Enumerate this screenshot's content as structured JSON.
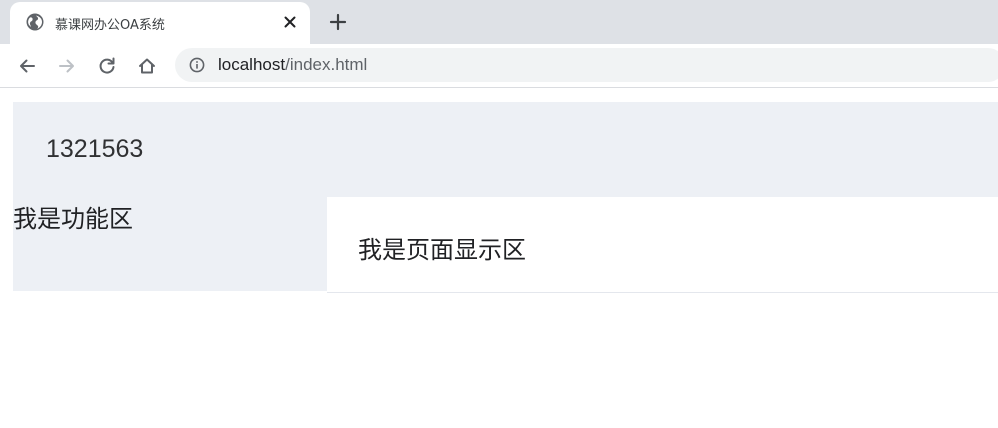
{
  "browser": {
    "tab": {
      "title": "慕课网办公OA系统",
      "favicon": "globe-icon",
      "close_icon": "close-icon"
    },
    "new_tab_icon": "plus-icon",
    "nav": {
      "back_icon": "back-arrow-icon",
      "forward_icon": "forward-arrow-icon",
      "reload_icon": "reload-icon",
      "home_icon": "home-icon"
    },
    "address_bar": {
      "info_icon": "info-icon",
      "host": "localhost",
      "path": "/index.html"
    }
  },
  "page": {
    "header_text": "1321563",
    "aside_text": "我是功能区",
    "main_text": "我是页面显示区"
  },
  "colors": {
    "tabstrip": "#dee1e6",
    "omnibox": "#f1f3f4",
    "panel_bg": "#edf0f5",
    "main_bg": "#ffffff"
  }
}
